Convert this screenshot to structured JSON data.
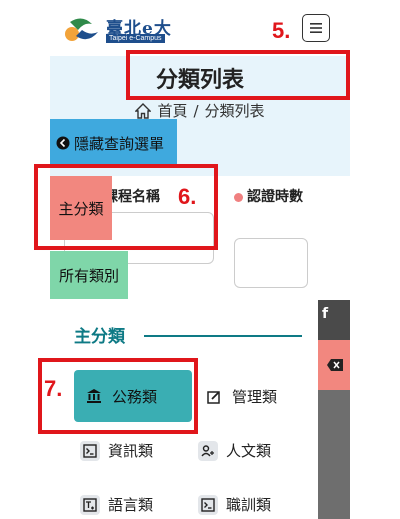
{
  "header": {
    "logo_text": "臺北e大",
    "logo_sub": "Taipei e-Campus",
    "menu_icon": "hamburger-icon"
  },
  "banner": {
    "title": "分類列表",
    "breadcrumb_home": "首頁",
    "breadcrumb_sep": "/",
    "breadcrumb_current": "分類列表",
    "home_icon": "home-icon"
  },
  "toggle_filter": {
    "label": "隱藏查詢選單",
    "icon": "arrow-left-circle-icon"
  },
  "form": {
    "course_name_label": "課程名稱",
    "cert_hours_label": "認證時數",
    "course_name_value": "",
    "cert_hours_value": ""
  },
  "chips": {
    "main_category": "主分類",
    "all_categories": "所有類別"
  },
  "categories": {
    "heading": "主分類",
    "items": [
      {
        "label": "公務類",
        "icon": "bank-icon",
        "active": true
      },
      {
        "label": "管理類",
        "icon": "edit-icon",
        "active": false
      },
      {
        "label": "資訊類",
        "icon": "terminal-icon",
        "active": false
      },
      {
        "label": "人文類",
        "icon": "people-icon",
        "active": false
      },
      {
        "label": "語言類",
        "icon": "language-icon",
        "active": false
      },
      {
        "label": "職訓類",
        "icon": "terminal-icon",
        "active": false
      }
    ]
  },
  "annotations": {
    "a5": "5.",
    "a6": "6.",
    "a7": "7."
  },
  "colors": {
    "accent": "#3aaeb3",
    "annotation": "#e0161b",
    "banner_bg": "#e7f4fb",
    "hide_btn": "#3fa9de"
  }
}
